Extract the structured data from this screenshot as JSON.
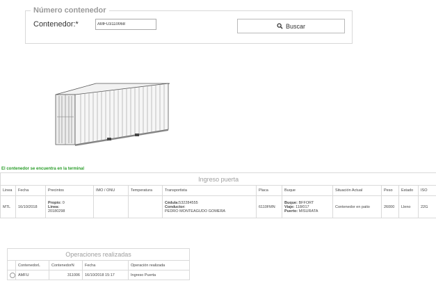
{
  "search": {
    "legend": "Número contenedor",
    "label": "Contenedor:*",
    "value": "AMFU3110068",
    "button": "Buscar",
    "button_icon": "search-icon"
  },
  "status_message": "El contenedor se encuentra en la terminal",
  "colors": {
    "status": "#2a9d2a"
  },
  "ingreso": {
    "title": "Ingreso puerta",
    "headers": [
      "Linea",
      "Fecha",
      "Precintos",
      "IMO / ONU",
      "Temperatura",
      "Transportista",
      "Placa",
      "Buque",
      "Situación Actual",
      "Peso",
      "Estado",
      "ISO"
    ],
    "row": {
      "linea": "MTL",
      "fecha": "16/10/2018",
      "propio_label": "Propio:",
      "propio_value": "0",
      "linea_label": "Linea:",
      "linea_value": "20180298",
      "imo": "",
      "temperatura": "",
      "cedula_label": "Cédula:",
      "cedula_value": "532284555",
      "conductor_label": "Conductor:",
      "conductor_value": "PEDRO MONTEAGUDO GOMERA",
      "placa": "6110FMN",
      "buque_label": "Buque:",
      "buque_value": "BFFORT",
      "viaje_label": "Viaje:",
      "viaje_value": "118/017",
      "puerto_label": "Puerto:",
      "puerto_value": "MISURATA",
      "situacion": "Contenedor en patio",
      "peso": "26000",
      "estado": "Lleno",
      "iso": "22G"
    }
  },
  "operaciones": {
    "title": "Operaciones realizadas",
    "headers": [
      "",
      "ContenedorL",
      "ContenedorN",
      "Fecha",
      "Operación realizada"
    ],
    "rows": [
      {
        "contl": "AMFU",
        "contn": "311006",
        "fecha": "16/10/2018 15:17",
        "op": "Ingreso Puerta"
      }
    ]
  }
}
